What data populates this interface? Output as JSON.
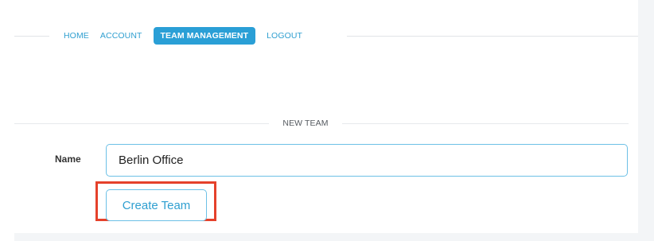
{
  "nav": {
    "items": [
      {
        "label": "HOME"
      },
      {
        "label": "ACCOUNT"
      },
      {
        "label": "TEAM MANAGEMENT"
      },
      {
        "label": "LOGOUT"
      }
    ],
    "active": "TEAM MANAGEMENT"
  },
  "section": {
    "title": "NEW TEAM"
  },
  "form": {
    "name_label": "Name",
    "name_value": "Berlin Office",
    "submit_label": "Create Team"
  },
  "colors": {
    "accent": "#2a9fd6",
    "highlight": "#e5412b"
  }
}
